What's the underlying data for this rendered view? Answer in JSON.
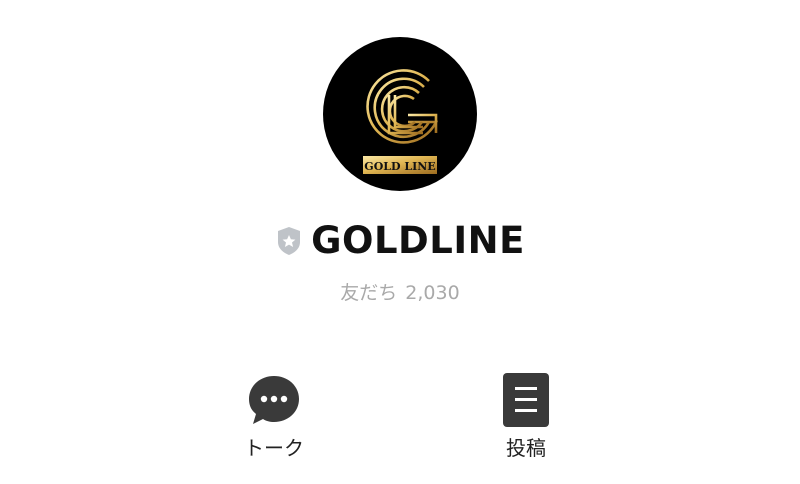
{
  "profile": {
    "avatar_icon": "goldline-logo",
    "logo_text": "GOLD LINE",
    "badge_icon": "shield-star-icon",
    "account_name": "GOLDLINE",
    "friends_label": "友だち",
    "friends_count": "2,030"
  },
  "actions": [
    {
      "label": "トーク",
      "icon": "chat-bubble-icon"
    },
    {
      "label": "投稿",
      "icon": "posts-icon"
    }
  ],
  "colors": {
    "gold_light": "#f3dc8a",
    "gold_dark": "#b8862d",
    "badge": "#bfc3c8",
    "icon_dark": "#3a3a3a",
    "muted_text": "#a9a9a9"
  }
}
